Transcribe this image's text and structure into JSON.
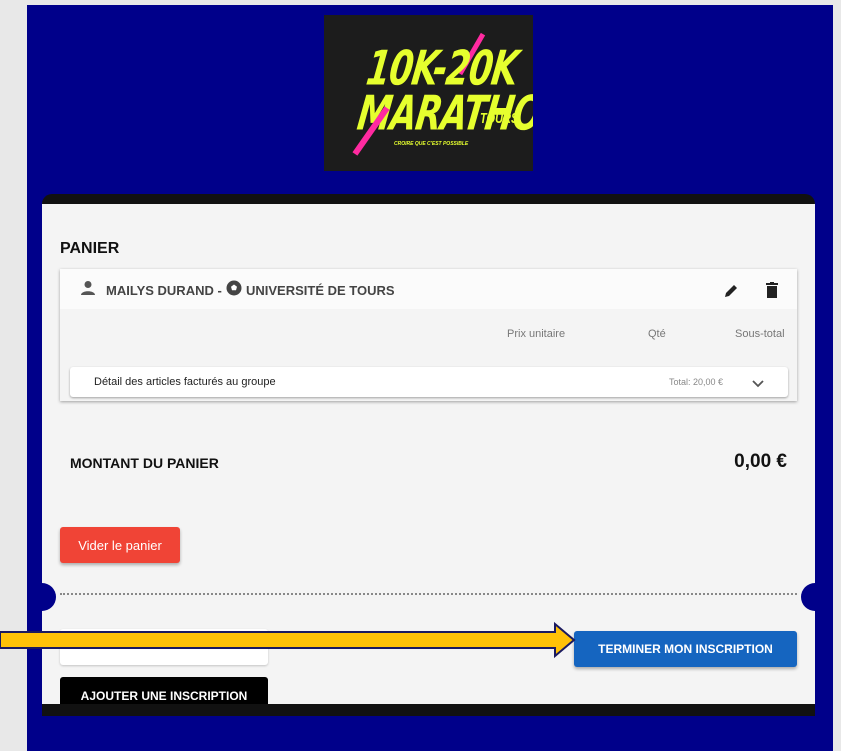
{
  "logo": {
    "line1": "10K-20K",
    "line2": "MARATHON",
    "line3": "TOURS",
    "tagline": "CROIRE QUE C'EST POSSIBLE"
  },
  "cart": {
    "title": "PANIER",
    "group": {
      "person_name": "MAILYS DURAND -",
      "club_name": "UNIVERSITÉ DE TOURS"
    },
    "columns": {
      "unit_price": "Prix unitaire",
      "qty": "Qté",
      "subtotal": "Sous-total"
    },
    "detail": {
      "label": "Détail des articles facturés au groupe",
      "total": "Total: 20,00 €"
    },
    "amount": {
      "label": "MONTANT DU PANIER",
      "value": "0,00 €"
    },
    "empty_button": "Vider le panier",
    "add_button": "AJOUTER UNE INSCRIPTION",
    "finish_button": "TERMINER MON INSCRIPTION"
  },
  "colors": {
    "background_navy": "#00008a",
    "finish_button": "#1565c0",
    "empty_button": "#f04436",
    "arrow_fill": "#ffc107"
  },
  "icons": [
    "person-icon",
    "football-icon",
    "pencil-icon",
    "trash-icon",
    "chevron-down-icon",
    "arrow-icon"
  ]
}
